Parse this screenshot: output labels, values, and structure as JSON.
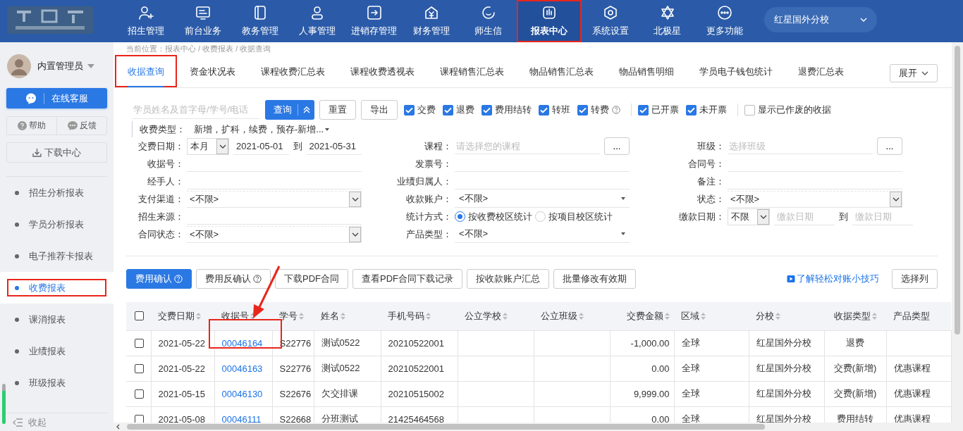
{
  "nav": {
    "items": [
      {
        "label": "招生管理",
        "selected": false,
        "highlighted": false
      },
      {
        "label": "前台业务",
        "selected": false,
        "highlighted": false
      },
      {
        "label": "教务管理",
        "selected": false,
        "highlighted": false
      },
      {
        "label": "人事管理",
        "selected": false,
        "highlighted": false
      },
      {
        "label": "进销存管理",
        "selected": false,
        "highlighted": false
      },
      {
        "label": "财务管理",
        "selected": false,
        "highlighted": false
      },
      {
        "label": "师生信",
        "selected": false,
        "highlighted": false
      },
      {
        "label": "报表中心",
        "selected": true,
        "highlighted": true
      },
      {
        "label": "系统设置",
        "selected": false,
        "highlighted": false
      },
      {
        "label": "北极星",
        "selected": false,
        "highlighted": false
      },
      {
        "label": "更多功能",
        "selected": false,
        "highlighted": false
      }
    ],
    "school_selector": "红星国外分校"
  },
  "sidebar": {
    "user": "内置管理员",
    "service_button": "在线客服",
    "help_button": "帮助",
    "feedback_button": "反馈",
    "download_button": "下载中心",
    "items": [
      {
        "label": "招生分析报表",
        "selected": false,
        "highlighted": false
      },
      {
        "label": "学员分析报表",
        "selected": false,
        "highlighted": false
      },
      {
        "label": "电子推荐卡报表",
        "selected": false,
        "highlighted": false
      },
      {
        "label": "收费报表",
        "selected": true,
        "highlighted": true
      },
      {
        "label": "课消报表",
        "selected": false,
        "highlighted": false
      },
      {
        "label": "业绩报表",
        "selected": false,
        "highlighted": false
      },
      {
        "label": "班级报表",
        "selected": false,
        "highlighted": false
      }
    ],
    "collapse": "收起"
  },
  "breadcrumb": "当前位置：报表中心 / 收费报表 / 收据查询",
  "tabs": [
    {
      "label": "收据查询",
      "selected": true,
      "highlighted": true
    },
    {
      "label": "资金状况表",
      "selected": false,
      "highlighted": false
    },
    {
      "label": "课程收费汇总表",
      "selected": false,
      "highlighted": false
    },
    {
      "label": "课程收费透视表",
      "selected": false,
      "highlighted": false
    },
    {
      "label": "课程销售汇总表",
      "selected": false,
      "highlighted": false
    },
    {
      "label": "物品销售汇总表",
      "selected": false,
      "highlighted": false
    },
    {
      "label": "物品销售明细",
      "selected": false,
      "highlighted": false
    },
    {
      "label": "学员电子钱包统计",
      "selected": false,
      "highlighted": false
    },
    {
      "label": "退费汇总表",
      "selected": false,
      "highlighted": false
    }
  ],
  "expand_button": "展开",
  "search": {
    "placeholder": "学员姓名及首字母/学号/电话",
    "query_button": "查询",
    "reset_button": "重置",
    "export_button": "导出",
    "filter_groups": [
      {
        "items": [
          {
            "label": "交费",
            "checked": true
          },
          {
            "label": "退费",
            "checked": true
          },
          {
            "label": "费用结转",
            "checked": true
          },
          {
            "label": "转班",
            "checked": true
          },
          {
            "label": "转费",
            "checked": true,
            "help": true
          }
        ]
      },
      {
        "items": [
          {
            "label": "已开票",
            "checked": true
          },
          {
            "label": "未开票",
            "checked": true
          }
        ]
      },
      {
        "items": [
          {
            "label": "显示已作废的收据",
            "checked": false
          }
        ]
      }
    ]
  },
  "receipt_type": {
    "label": "收费类型：",
    "value": "新增，扩科，续费，预存-新增..."
  },
  "form": {
    "rows": [
      [
        {
          "label": "交费日期：",
          "kind": "date_range",
          "preset": "本月",
          "from": "2021-05-01",
          "to_label": "到",
          "to": "2021-05-31"
        },
        {
          "label": "课程：",
          "kind": "picker",
          "placeholder": "请选择您的课程",
          "button": "..."
        },
        {
          "label": "班级：",
          "kind": "picker",
          "placeholder": "选择班级",
          "button": "..."
        }
      ],
      [
        {
          "label": "收据号：",
          "kind": "text"
        },
        {
          "label": "发票号：",
          "kind": "text"
        },
        {
          "label": "合同号：",
          "kind": "text"
        }
      ],
      [
        {
          "label": "经手人：",
          "kind": "text"
        },
        {
          "label": "业绩归属人：",
          "kind": "text"
        },
        {
          "label": "备注：",
          "kind": "text"
        }
      ],
      [
        {
          "label": "支付渠道：",
          "kind": "select",
          "value": "<不限>"
        },
        {
          "label": "收款账户：",
          "kind": "dropdown",
          "value": "<不限>"
        },
        {
          "label": "状态：",
          "kind": "select",
          "value": "<不限>"
        }
      ],
      [
        {
          "label": "招生来源：",
          "kind": "text"
        },
        {
          "label": "统计方式：",
          "kind": "radio",
          "options": [
            {
              "label": "按收费校区统计",
              "selected": true
            },
            {
              "label": "按项目校区统计",
              "selected": false
            }
          ]
        },
        {
          "label": "缴款日期：",
          "kind": "open_range",
          "preset": "不限",
          "from_placeholder": "缴款日期",
          "to_label": "到",
          "to_placeholder": "缴款日期"
        }
      ],
      [
        {
          "label": "合同状态：",
          "kind": "select",
          "value": "<不限>"
        },
        {
          "label": "产品类型：",
          "kind": "dropdown",
          "value": "<不限>"
        }
      ]
    ]
  },
  "actions": [
    {
      "label": "费用确认",
      "primary": true,
      "help": true
    },
    {
      "label": "费用反确认",
      "primary": false,
      "help": true
    },
    {
      "label": "下载PDF合同",
      "primary": false,
      "help": false
    },
    {
      "label": "查看PDF合同下载记录",
      "primary": false,
      "help": false
    },
    {
      "label": "按收款账户汇总",
      "primary": false,
      "help": false
    },
    {
      "label": "批量修改有效期",
      "primary": false,
      "help": false
    }
  ],
  "tips_link": "了解轻松对账小技巧",
  "columns_button": "选择列",
  "table": {
    "select_all": false,
    "columns": [
      {
        "label": "交费日期",
        "kind": "text"
      },
      {
        "label": "收据号",
        "kind": "link"
      },
      {
        "label": "学号",
        "kind": "text"
      },
      {
        "label": "姓名",
        "kind": "text"
      },
      {
        "label": "手机号码",
        "kind": "text"
      },
      {
        "label": "公立学校",
        "kind": "text"
      },
      {
        "label": "公立班级",
        "kind": "text"
      },
      {
        "label": "交费金额",
        "kind": "amount"
      },
      {
        "label": "区域",
        "kind": "text"
      },
      {
        "label": "分校",
        "kind": "text"
      },
      {
        "label": "收据类型",
        "kind": "tag"
      },
      {
        "label": "产品类型",
        "kind": "text"
      }
    ],
    "rows": [
      {
        "checked": false,
        "highlighted": true,
        "cells": [
          "2021-05-22",
          "00046164",
          "S22776",
          "测试0522",
          "20210522001",
          null,
          null,
          "-1,000.00",
          "全球",
          "红星国外分校",
          "退费",
          null
        ]
      },
      {
        "checked": false,
        "highlighted": false,
        "cells": [
          "2021-05-22",
          "00046163",
          "S22776",
          "测试0522",
          "20210522001",
          null,
          null,
          "0.00",
          "全球",
          "红星国外分校",
          "交费(新增)",
          "优惠课程"
        ]
      },
      {
        "checked": false,
        "highlighted": false,
        "cells": [
          "2021-05-15",
          "00046130",
          "S22676",
          "欠交排课",
          "20210515002",
          null,
          null,
          "9,999.00",
          "全球",
          "红星国外分校",
          "交费(新增)",
          "优惠课程"
        ]
      },
      {
        "checked": false,
        "highlighted": false,
        "cells": [
          "2021-05-08",
          "00046111",
          "S22668",
          "分班测试",
          "21425464568",
          null,
          null,
          "0.00",
          "全球",
          "红星国外分校",
          "费用结转",
          "优惠课程"
        ]
      }
    ]
  }
}
